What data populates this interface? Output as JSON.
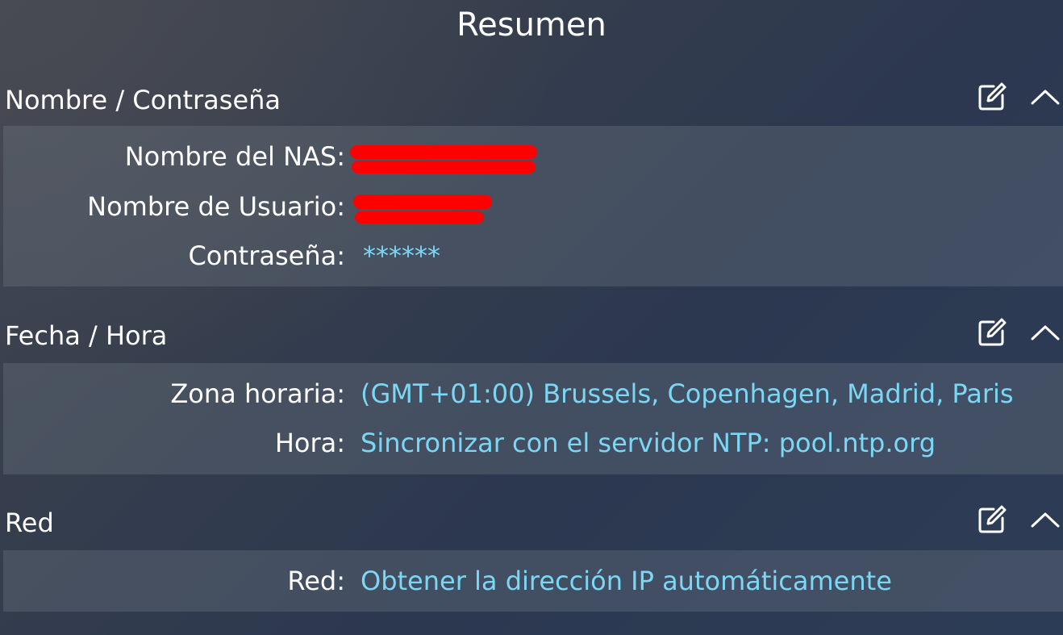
{
  "page": {
    "title": "Resumen"
  },
  "colors": {
    "value_text": "#7bd8f5",
    "label_text": "#ffffff",
    "redaction": "#ff0000"
  },
  "sections": {
    "credentials": {
      "title": "Nombre / Contraseña",
      "rows": {
        "nas_name": {
          "label": "Nombre del NAS:",
          "value": ""
        },
        "username": {
          "label": "Nombre de Usuario:",
          "value": ""
        },
        "password": {
          "label": "Contraseña:",
          "value": "******"
        }
      }
    },
    "datetime": {
      "title": "Fecha / Hora",
      "rows": {
        "timezone": {
          "label": "Zona horaria:",
          "value": "(GMT+01:00) Brussels, Copenhagen, Madrid, Paris"
        },
        "time": {
          "label": "Hora:",
          "value": "Sincronizar con el servidor NTP: pool.ntp.org"
        }
      }
    },
    "network": {
      "title": "Red",
      "rows": {
        "network": {
          "label": "Red:",
          "value": "Obtener la dirección IP automáticamente"
        }
      }
    }
  },
  "icons": {
    "edit": "edit-icon",
    "collapse": "chevron-up-icon"
  }
}
